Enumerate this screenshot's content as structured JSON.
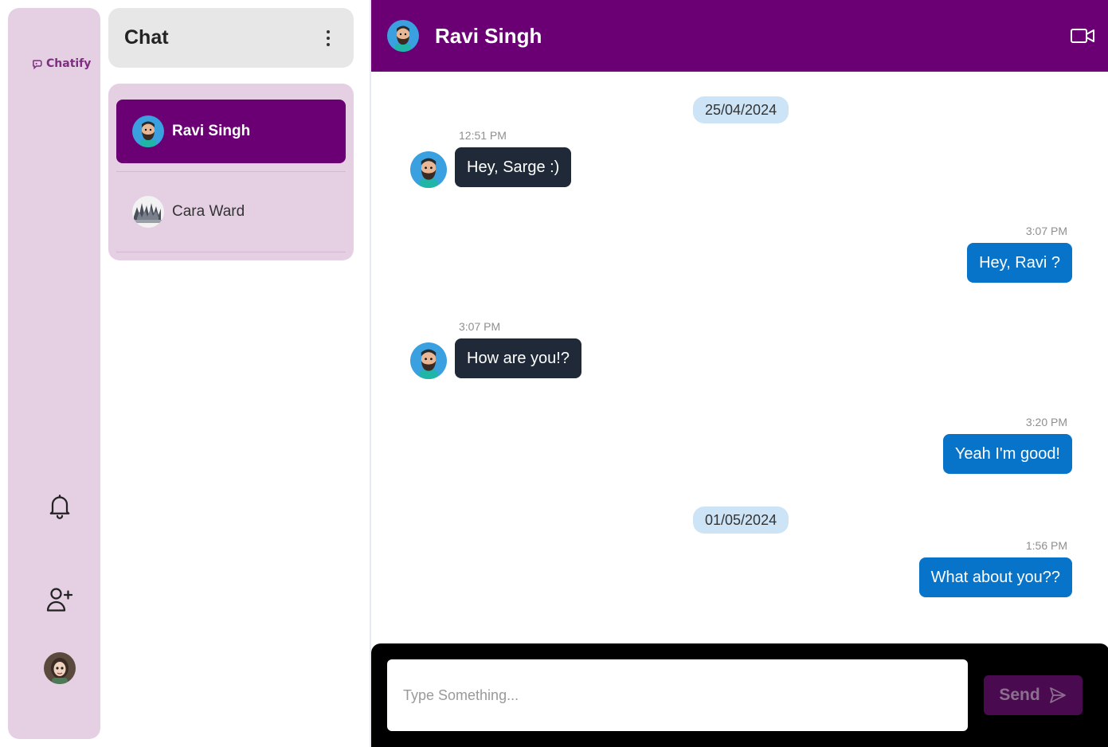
{
  "app": {
    "logo_text": "Chatify",
    "brand_color": "#6a0073",
    "rail_color": "#e5cfe3"
  },
  "sidebar_icons": [
    "bell-icon",
    "add-user-icon"
  ],
  "chat_list": {
    "title": "Chat",
    "contacts": [
      {
        "name": "Ravi Singh",
        "active": true
      },
      {
        "name": "Cara Ward",
        "active": false
      }
    ]
  },
  "conversation": {
    "title": "Ravi Singh",
    "video_icon": "video-camera-icon",
    "messages": [
      {
        "kind": "date",
        "text": "25/04/2024"
      },
      {
        "kind": "incoming",
        "time": "12:51 PM",
        "text": "Hey, Sarge :)"
      },
      {
        "kind": "outgoing",
        "time": "3:07 PM",
        "text": "Hey, Ravi ?"
      },
      {
        "kind": "incoming",
        "time": "3:07 PM",
        "text": "How are you!?"
      },
      {
        "kind": "outgoing",
        "time": "3:20 PM",
        "text": "Yeah I'm good!"
      },
      {
        "kind": "date",
        "text": "01/05/2024"
      },
      {
        "kind": "outgoing",
        "time": "1:56 PM",
        "text": "What about you??"
      }
    ]
  },
  "composer": {
    "placeholder": "Type Something...",
    "value": "",
    "send_label": "Send"
  }
}
